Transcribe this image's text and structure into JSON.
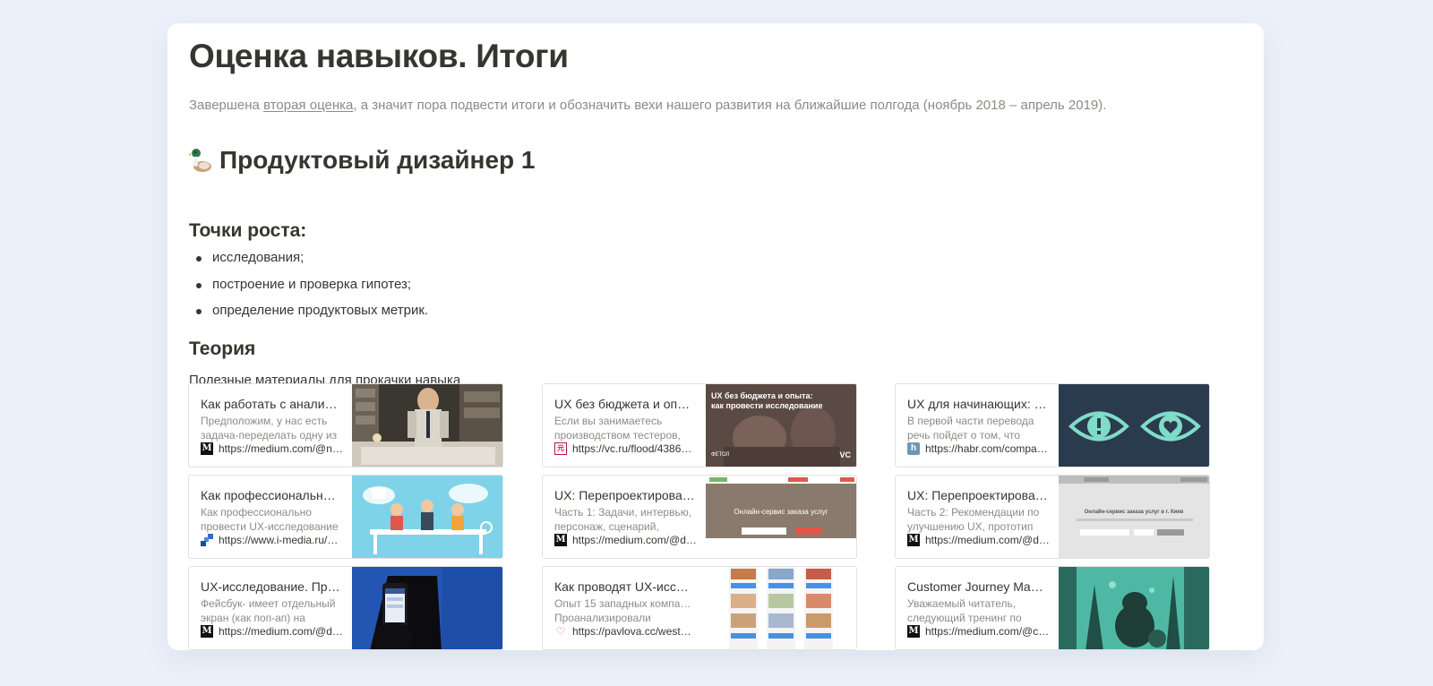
{
  "page": {
    "title": "Оценка навыков. Итоги",
    "intro_prefix": "Завершена ",
    "intro_link": "вторая оценка",
    "intro_suffix": ", а значит пора подвести итоги и обозначить вехи нашего развития на ближайшие полгода (ноябрь 2018 – апрель 2019)."
  },
  "section": {
    "title": "Продуктовый дизайнер 1",
    "growth_heading": "Точки роста:",
    "growth_items": [
      "исследования;",
      "построение и проверка гипотез;",
      "определение продуктовых метрик."
    ],
    "theory_heading": "Теория",
    "theory_desc": "Полезные материалы для прокачки навыка"
  },
  "bookmarks": [
    {
      "title": "Как работать с аналит…",
      "desc1": "Предположим, у нас есть",
      "desc2": "задача-переделать одну из",
      "url": "https://medium.com/@n…",
      "favicon": "medium-icon",
      "thumb_text": ""
    },
    {
      "title": "UX без бюджета и опы…",
      "desc1": "Если вы занимаетесь",
      "desc2": "производством тестеров,",
      "url": "https://vc.ru/flood/4386…",
      "favicon": "vc-icon",
      "thumb_text": "UX без бюджета и опыта: как провести исследование",
      "thumb_brand": "ФЕТОЛ",
      "thumb_logo": "VC"
    },
    {
      "title": "UX для начинающих: п…",
      "desc1": "В первой части перевода",
      "desc2": "речь пойдет о том, что",
      "url": "https://habr.com/compa…",
      "favicon": "habr-icon",
      "thumb_text": ""
    },
    {
      "title": "Как профессионально …",
      "desc1": "Как профессионально",
      "desc2": "провести UX-исследование",
      "url": "https://www.i-media.ru/…",
      "favicon": "imedia-icon",
      "thumb_text": ""
    },
    {
      "title": "UX: Перепроектирова…",
      "desc1": "Часть 1: Задачи, интервью,",
      "desc2": "персонаж, сценарий,",
      "url": "https://medium.com/@d…",
      "favicon": "medium-icon",
      "thumb_text": "Онлайн-сервис заказа услуг"
    },
    {
      "title": "UX: Перепроектирова…",
      "desc1": "Часть 2: Рекомендации по",
      "desc2": "улучшению UX, прототип",
      "url": "https://medium.com/@d…",
      "favicon": "medium-icon",
      "thumb_text": "Онлайн-сервис заказа услуг в г. Киев"
    },
    {
      "title": "UX-исследование. Пр…",
      "desc1": "Фейсбук- имеет отдельный",
      "desc2": "экран (как поп-ап) на",
      "url": "https://medium.com/@d…",
      "favicon": "medium-icon",
      "thumb_text": ""
    },
    {
      "title": "Как проводят UX-иссл…",
      "desc1": "Опыт 15 западных компаний",
      "desc2": "Проанализировали",
      "url": "https://pavlova.cc/west…",
      "favicon": "pavlova-icon",
      "thumb_text": ""
    },
    {
      "title": "Customer Journey Map …",
      "desc1": "Уважаемый читатель,",
      "desc2": "следующий тренинг по",
      "url": "https://medium.com/@c…",
      "favicon": "medium-icon",
      "thumb_text": ""
    }
  ]
}
